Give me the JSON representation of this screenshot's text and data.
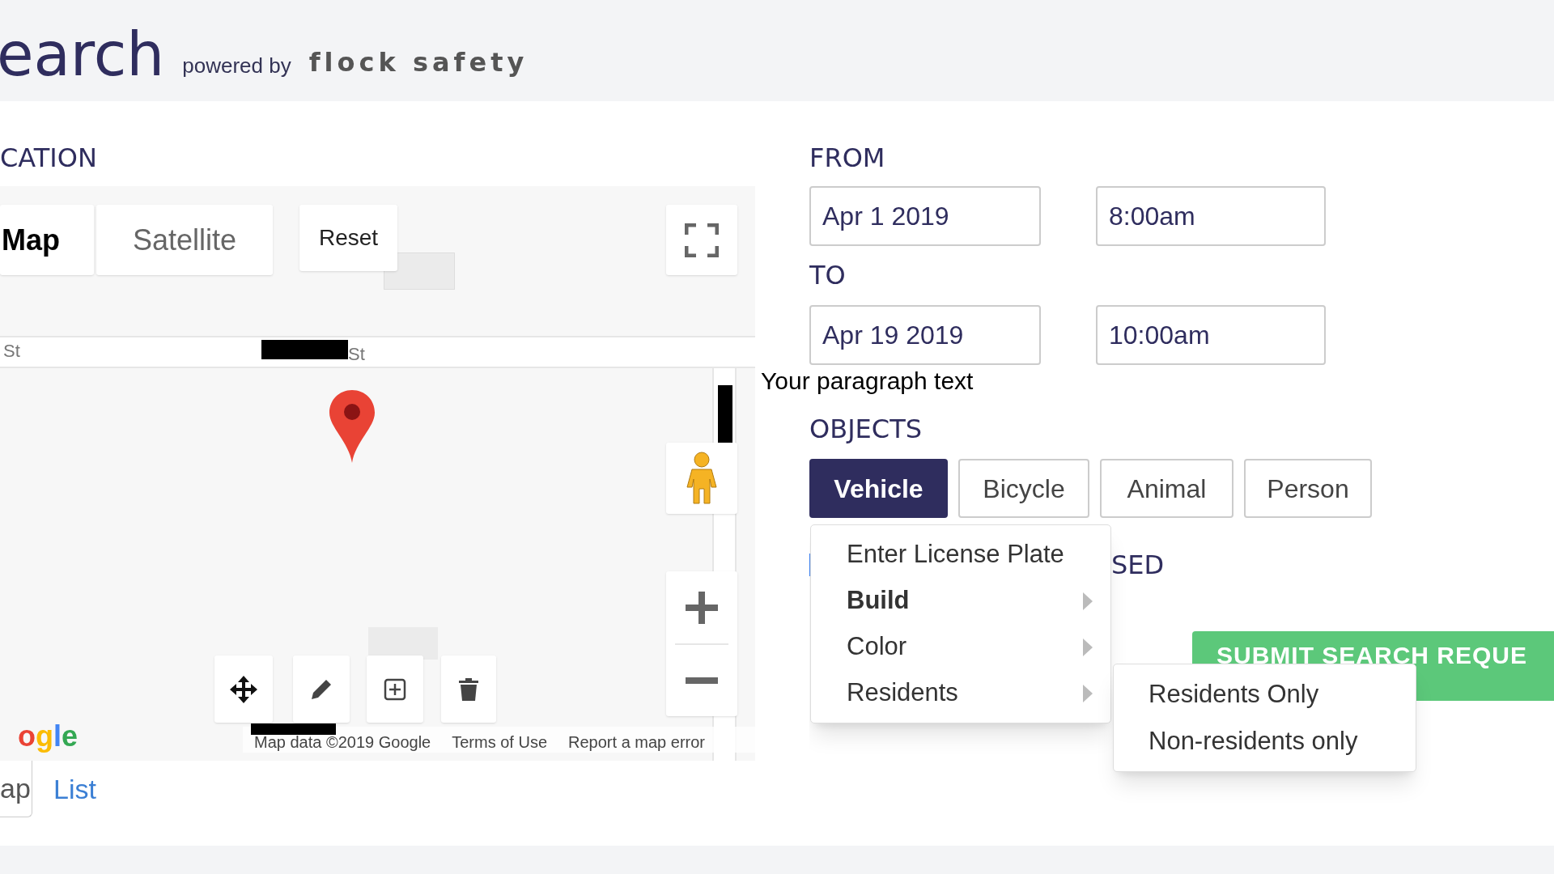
{
  "header": {
    "title": "earch",
    "powered_by": "powered by",
    "brand": "flock safety"
  },
  "location": {
    "heading": "CATION",
    "map": {
      "map_types": [
        {
          "label": "Map",
          "selected": true
        },
        {
          "label": "Satellite",
          "selected": false
        }
      ],
      "reset": "Reset",
      "streets": [
        "St",
        "St"
      ],
      "logo": "ogle",
      "attribution": [
        "Map data ©2019 Google",
        "Terms of Use",
        "Report a map error"
      ]
    },
    "view_tabs": [
      {
        "label": "ap",
        "selected": true
      },
      {
        "label": "List",
        "selected": false
      }
    ]
  },
  "overlay_text": "Your paragraph text",
  "from": {
    "heading": "FROM",
    "date": "Apr 1 2019",
    "time": "8:00am"
  },
  "to": {
    "heading": "TO",
    "date": "Apr 19 2019",
    "time": "10:00am"
  },
  "objects": {
    "heading": "OBJECTS",
    "options": [
      {
        "label": "Vehicle",
        "selected": true
      },
      {
        "label": "Bicycle",
        "selected": false
      },
      {
        "label": "Animal",
        "selected": false
      },
      {
        "label": "Person",
        "selected": false
      }
    ]
  },
  "partial_heading": "SED",
  "submit": "SUBMIT SEARCH REQUE",
  "menu": {
    "items": [
      {
        "label": "Enter License Plate",
        "has_submenu": false,
        "selected": false
      },
      {
        "label": "Build",
        "has_submenu": true,
        "selected": true
      },
      {
        "label": "Color",
        "has_submenu": true,
        "selected": false
      },
      {
        "label": "Residents",
        "has_submenu": true,
        "selected": false
      }
    ]
  },
  "submenu": {
    "items": [
      "Residents Only",
      "Non-residents only"
    ]
  }
}
